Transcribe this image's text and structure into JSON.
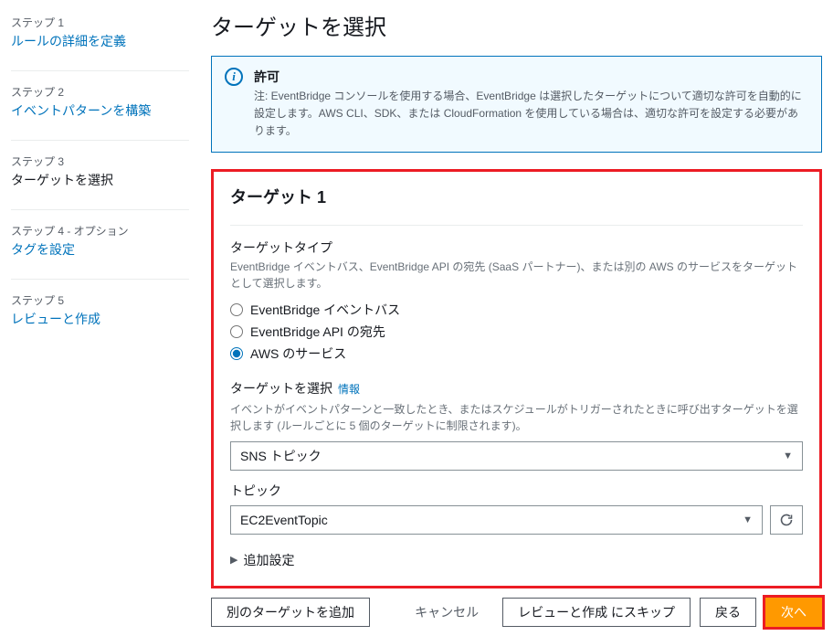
{
  "sidebar": {
    "steps": [
      {
        "label": "ステップ 1",
        "title": "ルールの詳細を定義",
        "current": false
      },
      {
        "label": "ステップ 2",
        "title": "イベントパターンを構築",
        "current": false
      },
      {
        "label": "ステップ 3",
        "title": "ターゲットを選択",
        "current": true
      },
      {
        "label": "ステップ 4 - オプション",
        "title": "タグを設定",
        "current": false
      },
      {
        "label": "ステップ 5",
        "title": "レビューと作成",
        "current": false
      }
    ]
  },
  "page": {
    "title": "ターゲットを選択"
  },
  "info": {
    "title": "許可",
    "body": "注: EventBridge コンソールを使用する場合、EventBridge は選択したターゲットについて適切な許可を自動的に設定します。AWS CLI、SDK、または CloudFormation を使用している場合は、適切な許可を設定する必要があります。"
  },
  "target": {
    "heading": "ターゲット 1",
    "type": {
      "label": "ターゲットタイプ",
      "hint": "EventBridge イベントバス、EventBridge API の宛先 (SaaS パートナー)、または別の AWS のサービスをターゲットとして選択します。",
      "options": {
        "bus": "EventBridge イベントバス",
        "api": "EventBridge API の宛先",
        "aws": "AWS のサービス"
      }
    },
    "select": {
      "label": "ターゲットを選択",
      "info": "情報",
      "hint": "イベントがイベントパターンと一致したとき、またはスケジュールがトリガーされたときに呼び出すターゲットを選択します (ルールごとに 5 個のターゲットに制限されます)。",
      "value": "SNS トピック"
    },
    "topic": {
      "label": "トピック",
      "value": "EC2EventTopic"
    },
    "expand": "追加設定"
  },
  "footer": {
    "add": "別のターゲットを追加",
    "cancel": "キャンセル",
    "skip": "レビューと作成 にスキップ",
    "back": "戻る",
    "next": "次へ"
  }
}
